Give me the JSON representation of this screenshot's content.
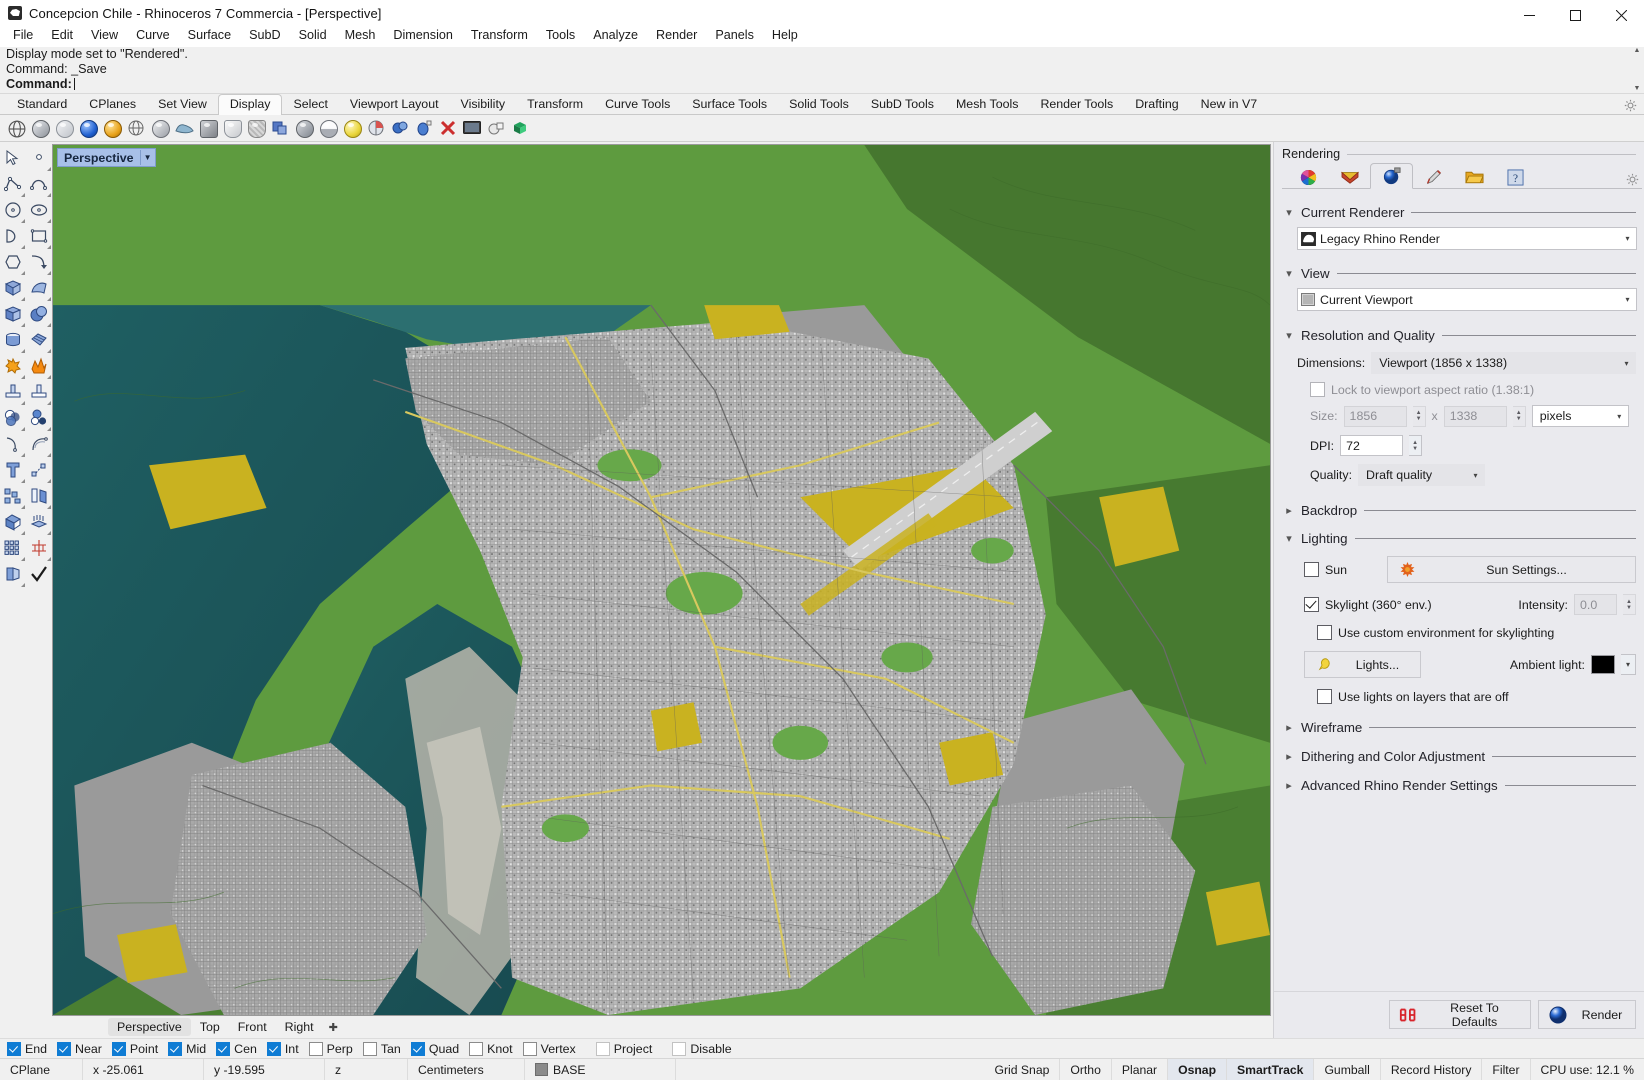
{
  "window": {
    "title": "Concepcion Chile - Rhinoceros 7 Commercia - [Perspective]",
    "app_icon": "rhino-icon",
    "controls": {
      "minimize": "minimize-icon",
      "maximize": "maximize-icon",
      "close": "close-icon"
    }
  },
  "menu": [
    "File",
    "Edit",
    "View",
    "Curve",
    "Surface",
    "SubD",
    "Solid",
    "Mesh",
    "Dimension",
    "Transform",
    "Tools",
    "Analyze",
    "Render",
    "Panels",
    "Help"
  ],
  "command": {
    "history": [
      "Display mode set to \"Rendered\".",
      "Command: _Save"
    ],
    "prompt_label": "Command:",
    "prompt_value": ""
  },
  "toolbar_tabs": {
    "items": [
      "Standard",
      "CPlanes",
      "Set View",
      "Display",
      "Select",
      "Viewport Layout",
      "Visibility",
      "Transform",
      "Curve Tools",
      "Surface Tools",
      "Solid Tools",
      "SubD Tools",
      "Mesh Tools",
      "Render Tools",
      "Drafting",
      "New in V7"
    ],
    "active": "Display",
    "options_icon": "gear-icon"
  },
  "display_toolbar_icons": [
    {
      "name": "wireframe-icon",
      "color": "#ffffff"
    },
    {
      "name": "shaded-icon",
      "color": "#b9bcc2"
    },
    {
      "name": "ghosted-icon",
      "color": "#d3d5d9"
    },
    {
      "name": "rendered-icon",
      "color": "#1f5fd0"
    },
    {
      "name": "arctic-icon",
      "color": "#e8a21a"
    },
    {
      "name": "xray-icon",
      "color": "#ffffff"
    },
    {
      "name": "technical-icon",
      "color": "#c8cbd0"
    },
    {
      "name": "pen-icon",
      "color": "#8fb6cf"
    },
    {
      "name": "artistic-icon",
      "color": "#9a9a9a"
    },
    {
      "name": "raytraced-icon",
      "color": "#d8d8d8"
    },
    {
      "name": "monochrome-icon",
      "color": "#cfcfcf"
    },
    {
      "name": "display-options-icon",
      "color": "#5577c4"
    },
    {
      "name": "shade-selected-icon",
      "color": "#9aa1ab"
    },
    {
      "name": "flat-shade-icon",
      "color": "#c9ccd1"
    },
    {
      "name": "yellow-sphere-icon",
      "color": "#ead63c"
    },
    {
      "name": "clipping-plane-icon",
      "color": "#d9534f"
    },
    {
      "name": "render-preview-icon",
      "color": "#3b6fc4"
    },
    {
      "name": "capture-viewport-icon",
      "color": "#3f74cc"
    },
    {
      "name": "clear-display-icon",
      "color": "#cc2f2f"
    },
    {
      "name": "fullscreen-icon",
      "color": "#3a3a3a"
    },
    {
      "name": "shaded-box-icon",
      "color": "#e0e0e0"
    },
    {
      "name": "color-cube-icon",
      "color": "#21a35d"
    }
  ],
  "left_toolbar_icons": [
    [
      "select-arrow-icon",
      "point-icon"
    ],
    [
      "polyline-icon",
      "curve-icon"
    ],
    [
      "circle-icon",
      "ellipse-icon"
    ],
    [
      "arc-icon",
      "rectangle-icon"
    ],
    [
      "polygon-icon",
      "fillet-curve-icon"
    ],
    [
      "surface-from-curves-icon",
      "surface-extrude-icon"
    ],
    [
      "box-icon",
      "sphere-icon"
    ],
    [
      "cylinder-icon",
      "surface-patch-icon"
    ],
    [
      "explode-icon",
      "boolean-icon"
    ],
    [
      "trim-icon",
      "split-icon"
    ],
    [
      "boolean-union-icon",
      "boolean-difference-icon"
    ],
    [
      "offset-curve-icon",
      "fillet-icon"
    ],
    [
      "text-icon",
      "dimension-icon"
    ],
    [
      "array-icon",
      "mirror-icon"
    ],
    [
      "shell-icon",
      "extrude-icon"
    ],
    [
      "grid-array-icon",
      "rotate-icon"
    ],
    [
      "copy-icon",
      "check-icon"
    ]
  ],
  "viewport": {
    "title": "Perspective",
    "dropdown_icon": "chevron-down-icon",
    "tabs": [
      "Perspective",
      "Top",
      "Front",
      "Right"
    ],
    "active_tab": "Perspective",
    "add_tab_icon": "plus-icon"
  },
  "rendering_panel": {
    "title": "Rendering",
    "tabs": [
      {
        "name": "materials-tab",
        "icon": "color-wheel-icon"
      },
      {
        "name": "environments-tab",
        "icon": "environment-icon"
      },
      {
        "name": "rendering-tab",
        "icon": "render-sphere-icon"
      },
      {
        "name": "ground-plane-tab",
        "icon": "brush-icon"
      },
      {
        "name": "render-window-tab",
        "icon": "folder-icon"
      },
      {
        "name": "help-tab",
        "icon": "info-icon"
      }
    ],
    "active_tab": "rendering-tab",
    "options_icon": "gear-icon",
    "current_renderer": {
      "section": "Current Renderer",
      "value": "Legacy Rhino Render",
      "icon": "rhino-render-icon"
    },
    "view": {
      "section": "View",
      "value": "Current Viewport",
      "icon": "viewport-icon"
    },
    "resolution": {
      "section": "Resolution and Quality",
      "dimensions_label": "Dimensions:",
      "dimensions_value": "Viewport (1856 x 1338)",
      "lock_label": "Lock to viewport aspect ratio (1.38:1)",
      "lock_checked": false,
      "size_label": "Size:",
      "size_width": "1856",
      "size_x": "x",
      "size_height": "1338",
      "size_units": "pixels",
      "dpi_label": "DPI:",
      "dpi_value": "72",
      "quality_label": "Quality:",
      "quality_value": "Draft quality"
    },
    "backdrop": {
      "section": "Backdrop",
      "expanded": false
    },
    "lighting": {
      "section": "Lighting",
      "sun_label": "Sun",
      "sun_checked": false,
      "sun_settings_button": "Sun Settings...",
      "sun_icon": "sun-icon",
      "skylight_label": "Skylight (360° env.)",
      "skylight_checked": true,
      "intensity_label": "Intensity:",
      "intensity_value": "0.0",
      "custom_env_label": "Use custom environment for skylighting",
      "custom_env_checked": false,
      "lights_button": "Lights...",
      "lights_icon": "lightbulb-icon",
      "ambient_label": "Ambient light:",
      "ambient_color": "#000000",
      "lights_off_label": "Use lights on layers that are off",
      "lights_off_checked": false
    },
    "wireframe": {
      "section": "Wireframe",
      "expanded": false
    },
    "dithering": {
      "section": "Dithering and Color Adjustment",
      "expanded": false
    },
    "advanced": {
      "section": "Advanced Rhino Render Settings",
      "expanded": false
    },
    "footer": {
      "reset_label": "Reset To Defaults",
      "reset_icon": "reset-counter-icon",
      "render_label": "Render",
      "render_icon": "render-sphere-icon"
    }
  },
  "osnap": [
    {
      "label": "End",
      "checked": true
    },
    {
      "label": "Near",
      "checked": true
    },
    {
      "label": "Point",
      "checked": true
    },
    {
      "label": "Mid",
      "checked": true
    },
    {
      "label": "Cen",
      "checked": true
    },
    {
      "label": "Int",
      "checked": true
    },
    {
      "label": "Perp",
      "checked": false
    },
    {
      "label": "Tan",
      "checked": false
    },
    {
      "label": "Quad",
      "checked": true
    },
    {
      "label": "Knot",
      "checked": false
    },
    {
      "label": "Vertex",
      "checked": false
    },
    {
      "label": "Project",
      "checked": false,
      "pale": true
    },
    {
      "label": "Disable",
      "checked": false,
      "pale": true
    }
  ],
  "statusbar": {
    "cplane": "CPlane",
    "x": "x -25.061",
    "y": "y -19.595",
    "z": "z",
    "units": "Centimeters",
    "layer": "BASE",
    "layer_color": "#8b8b8b",
    "toggles": [
      {
        "label": "Grid Snap",
        "bold": false
      },
      {
        "label": "Ortho",
        "bold": false
      },
      {
        "label": "Planar",
        "bold": false
      },
      {
        "label": "Osnap",
        "bold": true
      },
      {
        "label": "SmartTrack",
        "bold": true
      },
      {
        "label": "Gumball",
        "bold": false
      },
      {
        "label": "Record History",
        "bold": false
      },
      {
        "label": "Filter",
        "bold": false
      }
    ],
    "cpu": "CPU use: 12.1 %"
  }
}
